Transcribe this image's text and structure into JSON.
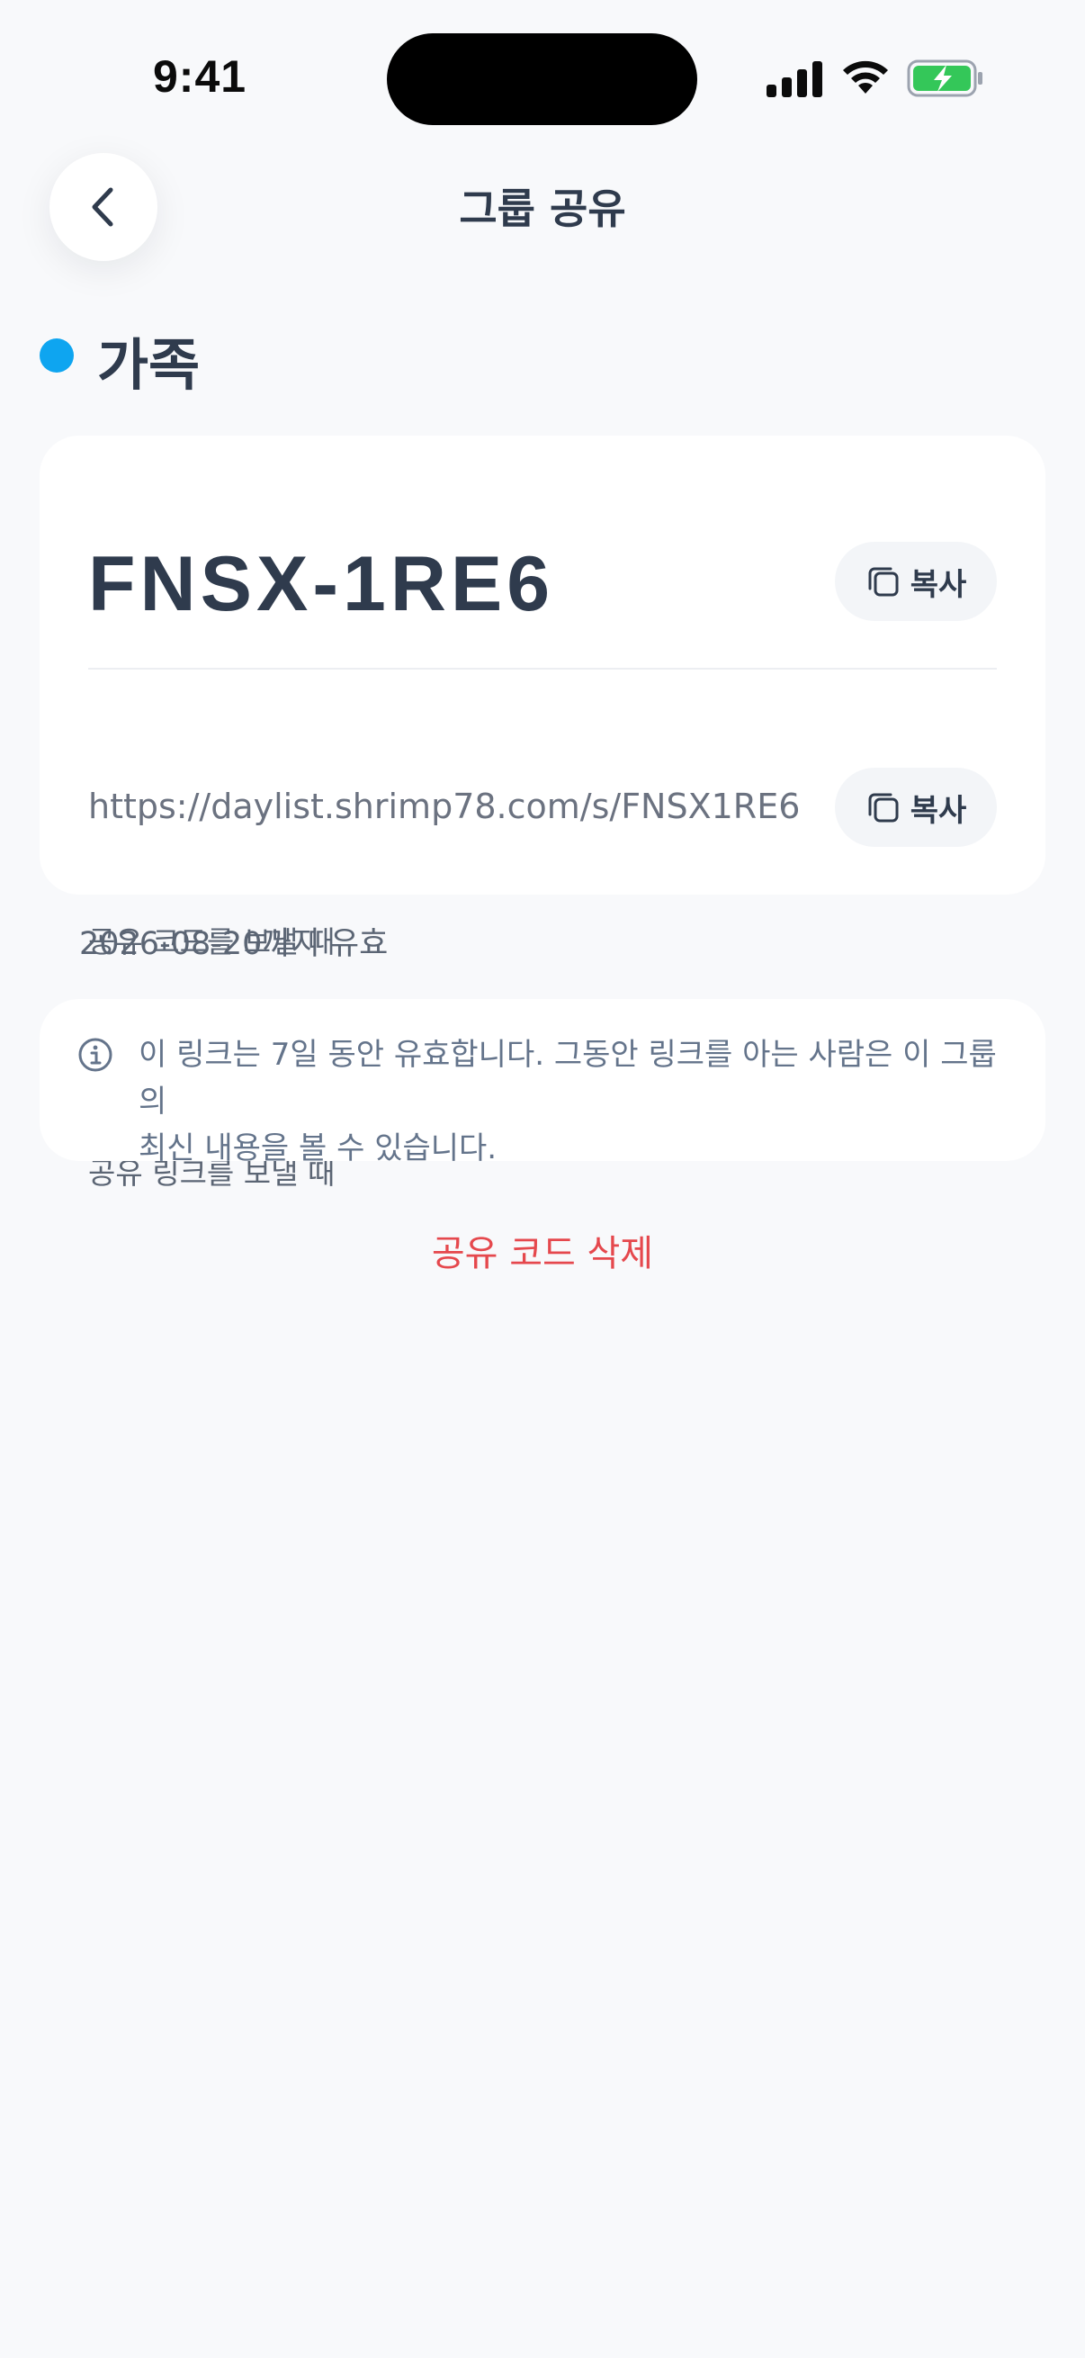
{
  "status_bar": {
    "time": "9:41"
  },
  "header": {
    "title": "그룹 공유",
    "back_icon": "chevron-left-icon"
  },
  "group": {
    "name": "가족",
    "color": "#0ea5f0"
  },
  "share": {
    "code_label": "공유 코드를 보낼 때",
    "code": "FNSX-1RE6",
    "link_label": "공유 링크를 보낼 때",
    "link": "https://daylist.shrimp78.com/s/FNSX1RE6",
    "copy_label": "복사",
    "copy_icon": "copy-icon"
  },
  "expiry": "2026-08-20까지 유효",
  "info": {
    "icon": "info-icon",
    "line1": "이 링크는 7일 동안 유효합니다. 그동안 링크를 아는 사람은 이 그룹의",
    "line2": "최신 내용을 볼 수 있습니다."
  },
  "delete_label": "공유 코드 삭제",
  "colors": {
    "background": "#f8f9fb",
    "text_primary": "#2f3b4d",
    "danger": "#e5484d",
    "battery": "#34c759"
  }
}
